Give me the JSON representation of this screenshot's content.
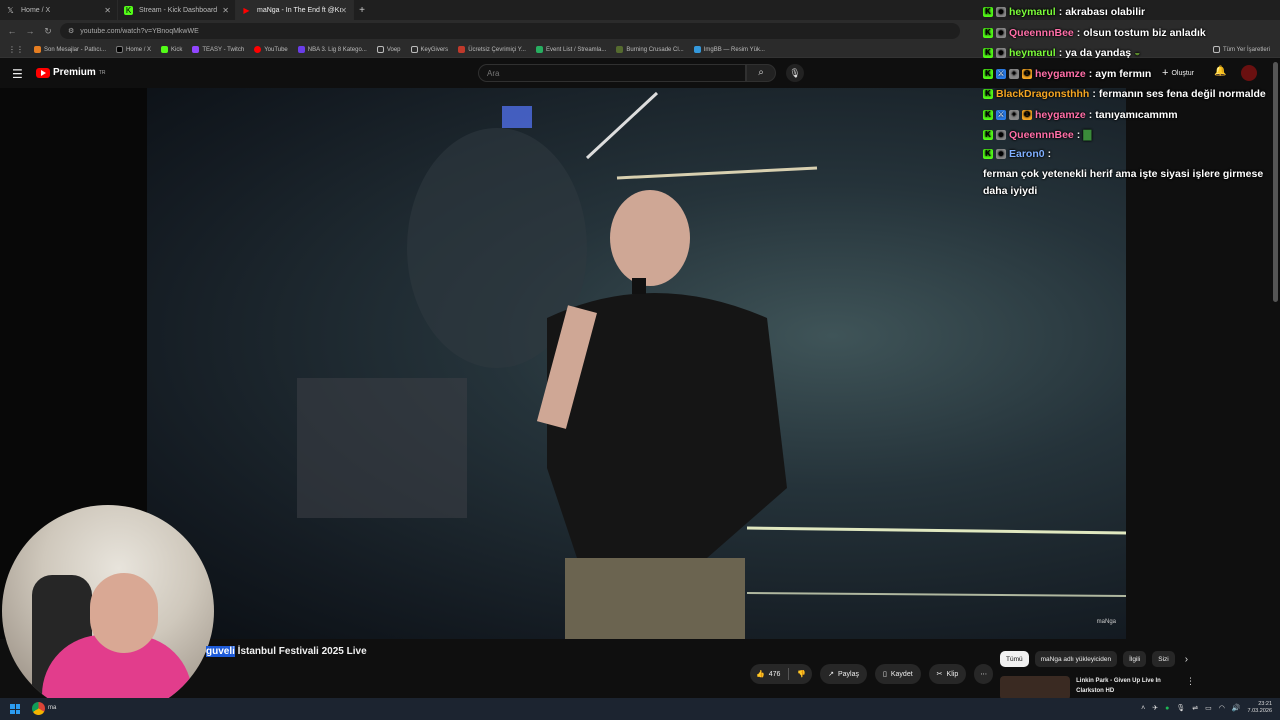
{
  "browser": {
    "tabs": [
      {
        "label": "Home / X",
        "icon": "x-icon"
      },
      {
        "label": "Stream - Kick Dashboard",
        "icon": "kick-icon"
      },
      {
        "label": "maNga - In The End ft @Kı",
        "icon": "youtube-icon"
      }
    ],
    "url": "youtube.com/watch?v=YBnoqMkwWE",
    "bookmarks": [
      "Son Mesajlar - Patlıcı...",
      "Home / X",
      "Kick",
      "TEASY - Twitch",
      "YouTube",
      "NBA 3. Lig 8 Katego...",
      "Voep",
      "KeyGivers",
      "Ücretsiz Çevrimiçi Y...",
      "Event List / Streamla...",
      "Burning Crusade Cl...",
      "ImgBB — Resim Yük..."
    ],
    "all_bookmarks": "Tüm Yer İşaretleri"
  },
  "youtube": {
    "logo": "Premium",
    "region": "TR",
    "search_placeholder": "Ara",
    "create": "Oluştur",
    "video_watermark": "maNga",
    "title_highlight": "guveli",
    "title_rest": " İstanbul Festivali 2025 Live",
    "likes": "476",
    "share": "Paylaş",
    "save": "Kaydet",
    "clip": "Klip",
    "chips": [
      "Tümü",
      "maNga adlı yükleyiciden",
      "İlgili",
      "Sizi"
    ],
    "rec_title": "Linkin Park - Given Up Live In Clarkston HD"
  },
  "chat": [
    {
      "user": "heymarul",
      "color": "#7cfc3a",
      "text": "akrabası olabilir"
    },
    {
      "user": "QueennnBee",
      "color": "#ff6fa8",
      "text": "olsun tostum biz anladık"
    },
    {
      "user": "heymarul",
      "color": "#7cfc3a",
      "text": "ya da yandaş"
    },
    {
      "user": "heygamze",
      "color": "#ff6fa8",
      "text": "aym fermın"
    },
    {
      "user": "BlackDragonsthhh",
      "color": "#f5a623",
      "text": "fermanın ses fena değil normalde"
    },
    {
      "user": "heygamze",
      "color": "#ff6fa8",
      "text": "tanıyamıcammm"
    },
    {
      "user": "QueennnBee",
      "color": "#ff6fa8",
      "text": ""
    },
    {
      "user": "Earon0",
      "color": "#7fb0ff",
      "text": "ferman çok yetenekli herif ama işte siyasi işlere girmese daha iyiydi"
    }
  ],
  "taskbar": {
    "app_label": "ma",
    "time": "23:21",
    "date": "7.03.2026"
  }
}
